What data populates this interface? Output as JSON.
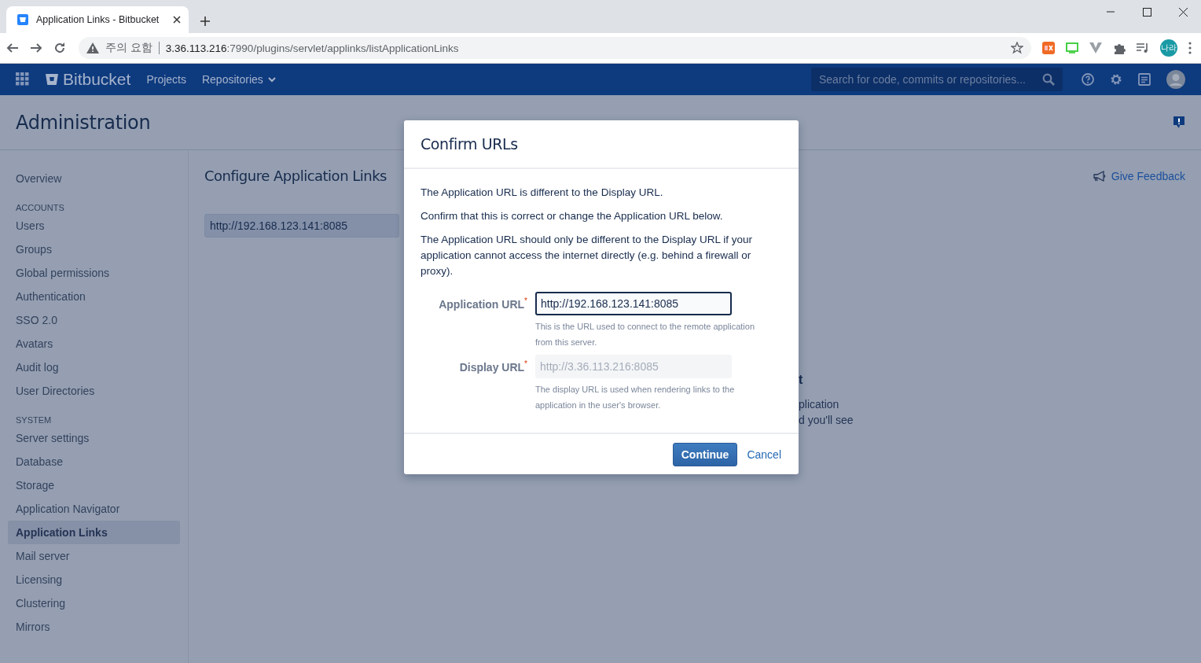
{
  "browser": {
    "tab_title": "Application Links - Bitbucket",
    "security_label": "주의 요함",
    "url_host": "3.36.113.216",
    "url_path": ":7990/plugins/servlet/applinks/listApplicationLinks",
    "profile_initials": "나라"
  },
  "nav": {
    "product": "Bitbucket",
    "links": [
      {
        "label": "Projects",
        "dropdown": false
      },
      {
        "label": "Repositories",
        "dropdown": true
      }
    ],
    "search": {
      "placeholder": "Search for code, commits or repositories..."
    }
  },
  "page": {
    "title": "Administration",
    "sidebar": {
      "items": [
        {
          "kind": "link",
          "label": "Overview",
          "selected": false
        },
        {
          "kind": "heading",
          "label": "ACCOUNTS"
        },
        {
          "kind": "link",
          "label": "Users",
          "selected": false
        },
        {
          "kind": "link",
          "label": "Groups",
          "selected": false
        },
        {
          "kind": "link",
          "label": "Global permissions",
          "selected": false
        },
        {
          "kind": "link",
          "label": "Authentication",
          "selected": false
        },
        {
          "kind": "link",
          "label": "SSO 2.0",
          "selected": false
        },
        {
          "kind": "link",
          "label": "Avatars",
          "selected": false
        },
        {
          "kind": "link",
          "label": "Audit log",
          "selected": false
        },
        {
          "kind": "link",
          "label": "User Directories",
          "selected": false
        },
        {
          "kind": "heading",
          "label": "SYSTEM"
        },
        {
          "kind": "link",
          "label": "Server settings",
          "selected": false
        },
        {
          "kind": "link",
          "label": "Database",
          "selected": false
        },
        {
          "kind": "link",
          "label": "Storage",
          "selected": false
        },
        {
          "kind": "link",
          "label": "Application Navigator",
          "selected": false
        },
        {
          "kind": "link",
          "label": "Application Links",
          "selected": true
        },
        {
          "kind": "link",
          "label": "Mail server",
          "selected": false
        },
        {
          "kind": "link",
          "label": "Licensing",
          "selected": false
        },
        {
          "kind": "link",
          "label": "Clustering",
          "selected": false
        },
        {
          "kind": "link",
          "label": "Mirrors",
          "selected": false
        }
      ]
    },
    "content": {
      "title": "Configure Application Links",
      "url_value": "http://192.168.123.141:8085",
      "feedback_link": "Give Feedback",
      "covered_heading": "t",
      "covered_lines": [
        "plication",
        "d you'll see"
      ]
    }
  },
  "dialog": {
    "title": "Confirm URLs",
    "paragraphs": [
      "The Application URL is different to the Display URL.",
      "Confirm that this is correct or change the Application URL below.",
      "The Application URL should only be different to the Display URL if your application cannot access the internet directly (e.g. behind a firewall or proxy)."
    ],
    "fields": [
      {
        "label": "Application URL",
        "required_mark": "*",
        "value": "http://192.168.123.141:8085",
        "disabled": false,
        "focused": true,
        "help": "This is the URL used to connect to the remote application from this server."
      },
      {
        "label": "Display URL",
        "required_mark": "*",
        "value": "http://3.36.113.216:8085",
        "disabled": true,
        "focused": false,
        "help": "The display URL is used when rendering links to the application in the user's browser."
      }
    ],
    "buttons": [
      {
        "kind": "primary",
        "label": "Continue"
      },
      {
        "kind": "link",
        "label": "Cancel"
      }
    ]
  }
}
